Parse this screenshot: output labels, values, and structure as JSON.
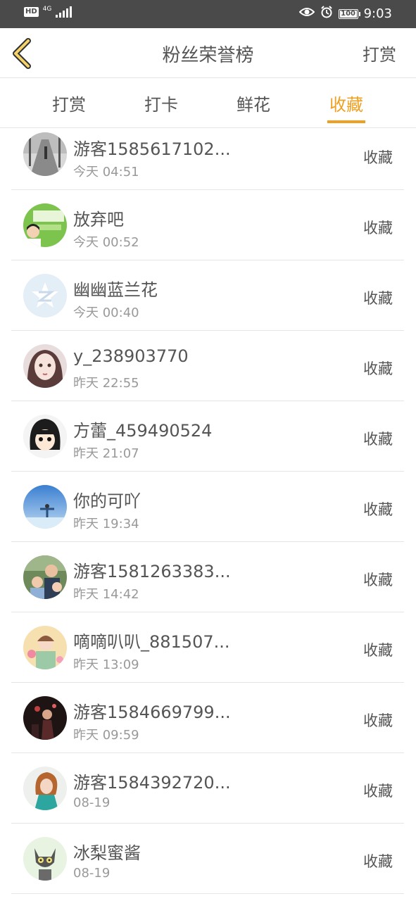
{
  "status_bar": {
    "hd": "HD",
    "network": "4G",
    "time": "9:03",
    "battery": "100"
  },
  "header": {
    "title": "粉丝荣誉榜",
    "right_action": "打赏",
    "back_icon": "chevron-left-icon",
    "accent_color": "#f0a020"
  },
  "tabs": [
    {
      "label": "打赏",
      "active": false
    },
    {
      "label": "打卡",
      "active": false
    },
    {
      "label": "鲜花",
      "active": false
    },
    {
      "label": "收藏",
      "active": true
    }
  ],
  "rows": [
    {
      "name": "游客1585617102...",
      "time": "今天 04:51",
      "action": "收藏"
    },
    {
      "name": "放弃吧",
      "time": "今天 00:52",
      "action": "收藏"
    },
    {
      "name": "幽幽蓝兰花",
      "time": "今天 00:40",
      "action": "收藏"
    },
    {
      "name": "y_238903770",
      "time": "昨天 22:55",
      "action": "收藏"
    },
    {
      "name": "方蕾_459490524",
      "time": "昨天 21:07",
      "action": "收藏"
    },
    {
      "name": "你的可吖",
      "time": "昨天 19:34",
      "action": "收藏"
    },
    {
      "name": "游客1581263383...",
      "time": "昨天 14:42",
      "action": "收藏"
    },
    {
      "name": "嘀嘀叭叭_881507...",
      "time": "昨天 13:09",
      "action": "收藏"
    },
    {
      "name": "游客1584669799...",
      "time": "昨天 09:59",
      "action": "收藏"
    },
    {
      "name": "游客1584392720...",
      "time": "08-19",
      "action": "收藏"
    },
    {
      "name": "冰梨蜜酱",
      "time": "08-19",
      "action": "收藏"
    }
  ]
}
